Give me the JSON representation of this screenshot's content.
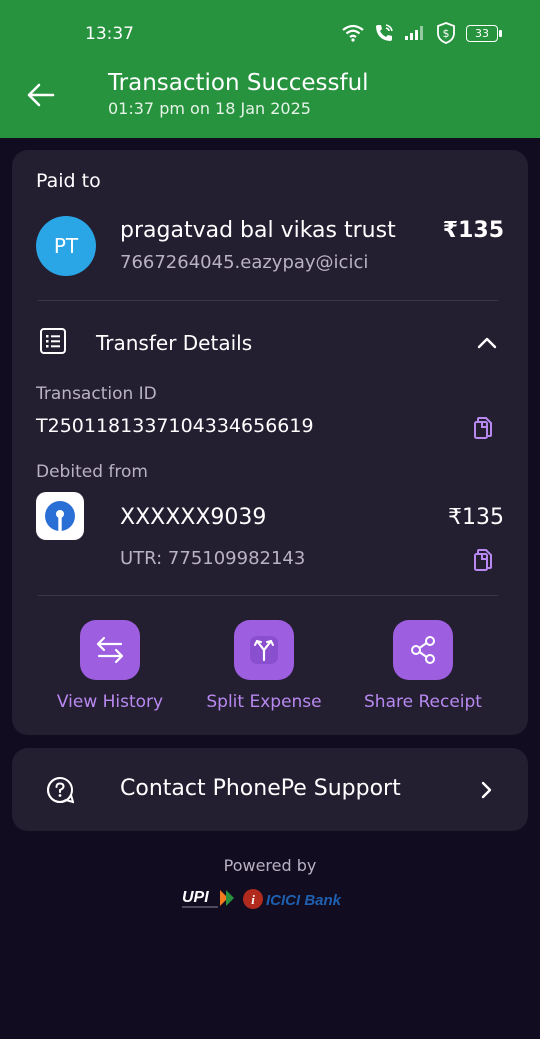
{
  "status_bar": {
    "time": "13:37",
    "battery": "33",
    "icons": [
      "wifi-icon",
      "wifi-call-icon",
      "signal-icon",
      "shield-dollar-icon",
      "battery-icon"
    ]
  },
  "header": {
    "title": "Transaction Successful",
    "subtitle": "01:37 pm on 18 Jan 2025",
    "background": "#27933e"
  },
  "paid_to": {
    "label": "Paid to",
    "initials": "PT",
    "name": "pragatvad bal vikas trust",
    "upi_id": "7667264045.eazypay@icici",
    "amount": "₹135",
    "avatar_color": "#2aa5e6"
  },
  "transfer_details": {
    "label": "Transfer Details",
    "transaction_id_label": "Transaction ID",
    "transaction_id": "T2501181337104334656619",
    "debited_from_label": "Debited from",
    "account": "XXXXXX9039",
    "amount": "₹135",
    "utr": "UTR: 775109982143"
  },
  "actions": [
    {
      "label": "View History",
      "icon": "transfer-arrows-icon"
    },
    {
      "label": "Split Expense",
      "icon": "split-icon"
    },
    {
      "label": "Share Receipt",
      "icon": "share-icon"
    }
  ],
  "support": {
    "label": "Contact PhonePe Support"
  },
  "footer": {
    "powered_by": "Powered by",
    "logos": [
      "UPI",
      "ICICI Bank"
    ]
  },
  "colors": {
    "accent": "#9d5ee0",
    "accent_text": "#b889f0",
    "card": "#241e31",
    "background": "#110c1f"
  }
}
